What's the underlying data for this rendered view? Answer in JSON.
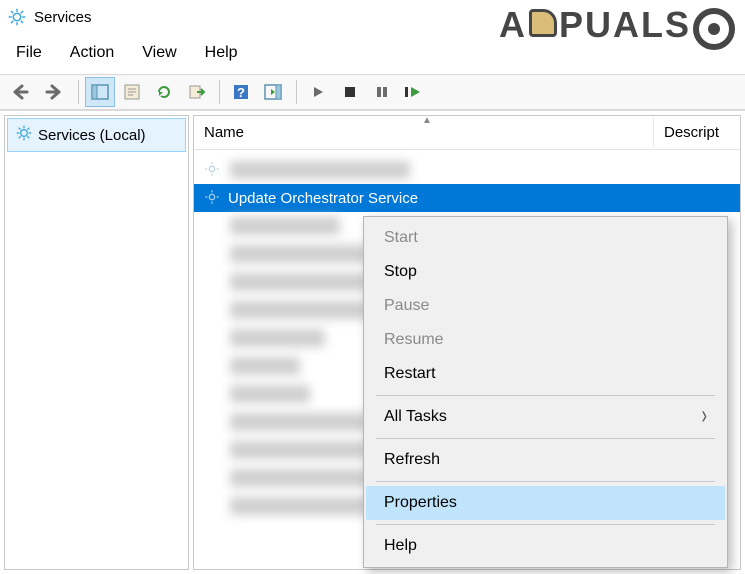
{
  "window": {
    "title": "Services"
  },
  "menu": {
    "file": "File",
    "action": "Action",
    "view": "View",
    "help": "Help"
  },
  "sidebar": {
    "label": "Services (Local)"
  },
  "columns": {
    "name": "Name",
    "description": "Descript"
  },
  "services": {
    "selected": "Update Orchestrator Service"
  },
  "context_menu": {
    "start": "Start",
    "stop": "Stop",
    "pause": "Pause",
    "resume": "Resume",
    "restart": "Restart",
    "all_tasks": "All Tasks",
    "refresh": "Refresh",
    "properties": "Properties",
    "help": "Help"
  },
  "watermark": {
    "text_left": "A",
    "text_right": "PUALS"
  }
}
